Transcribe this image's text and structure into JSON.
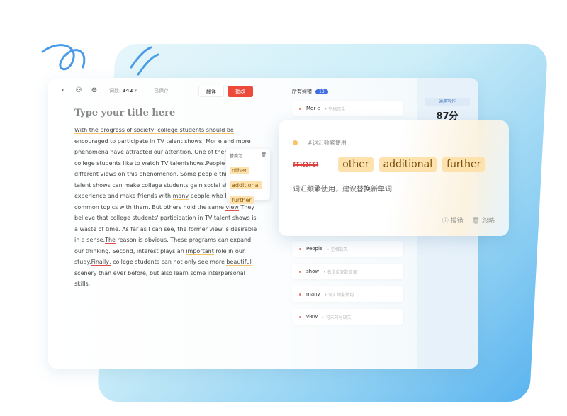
{
  "toolbar": {
    "word_count_label": "词数:",
    "word_count": "142",
    "saved": "已保存",
    "translate": "翻译",
    "correct": "批改"
  },
  "editor": {
    "title_placeholder": "Type your title here",
    "paragraph": [
      {
        "t": "With the progress of society, college students should be encouraged to participate in TV talent shows. ",
        "u": "y"
      },
      {
        "t": "Mor e",
        "u": "r"
      },
      {
        "t": " and "
      },
      {
        "t": "more",
        "u": "y"
      },
      {
        "t": " phenomena have attracted our attention. One of them is that college students "
      },
      {
        "t": "like",
        "u": "y"
      },
      {
        "t": " to watch TV "
      },
      {
        "t": "talentshows.People",
        "u": "r"
      },
      {
        "t": " hold different views on this phenomenon. Some people think that TV talent shows can make college students gain social status experience and make friends with "
      },
      {
        "t": "many",
        "u": "y"
      },
      {
        "t": " people who have common topics with them. But others hold the same "
      },
      {
        "t": "view",
        "u": "r"
      },
      {
        "t": " They believe that college students' participation in TV talent shows is a waste of time. As far as I can see, the former view is desirable in a sense."
      },
      {
        "t": "The",
        "u": "r"
      },
      {
        "t": " reason is obvious. These programs can expand our thinking. Second, interest plays an "
      },
      {
        "t": "important",
        "u": "y"
      },
      {
        "t": " role in our study."
      },
      {
        "t": "Finally,",
        "u": "r"
      },
      {
        "t": " college students can not only see more "
      },
      {
        "t": "beautiful",
        "u": "y"
      },
      {
        "t": " scenery than ever before, but also learn some interpersonal skills."
      }
    ]
  },
  "tooltip": {
    "heading": "替换为",
    "options": [
      "other",
      "additional",
      "further"
    ]
  },
  "errors": {
    "heading": "所有纠错",
    "count": "13",
    "items": [
      {
        "word": "Mor e",
        "type": "空格冗余"
      },
      {
        "word": "People",
        "type": "空格缺失"
      },
      {
        "word": "show",
        "type": "名次单复数错误"
      },
      {
        "word": "many",
        "type": "词汇频繁使用"
      },
      {
        "word": "view",
        "type": "句末句号缺失"
      }
    ]
  },
  "score": {
    "label": "通用写作",
    "value": "87分"
  },
  "popup": {
    "tag": "#词汇频繁使用",
    "original": "more",
    "suggestions": [
      "other",
      "additional",
      "further"
    ],
    "description": "词汇频繁使用，建议替换新单词",
    "report": "报错",
    "ignore": "忽略"
  }
}
